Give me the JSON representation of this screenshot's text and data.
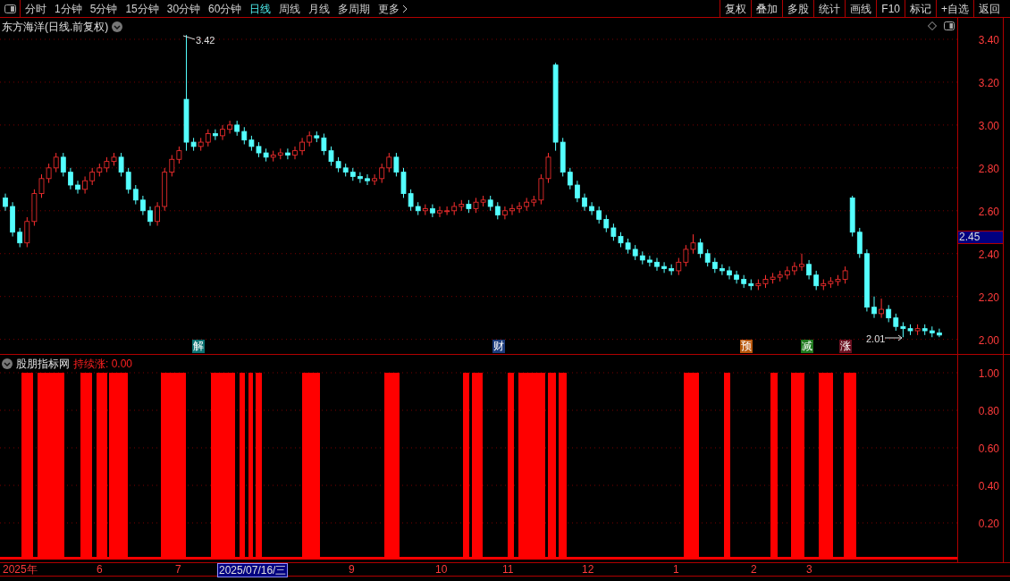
{
  "toolbar": {
    "periods": [
      {
        "label": "分时",
        "selected": false
      },
      {
        "label": "1分钟",
        "selected": false
      },
      {
        "label": "5分钟",
        "selected": false
      },
      {
        "label": "15分钟",
        "selected": false
      },
      {
        "label": "30分钟",
        "selected": false
      },
      {
        "label": "60分钟",
        "selected": false
      },
      {
        "label": "日线",
        "selected": true
      },
      {
        "label": "周线",
        "selected": false
      },
      {
        "label": "月线",
        "selected": false
      },
      {
        "label": "多周期",
        "selected": false
      }
    ],
    "more": "更多",
    "actions": [
      "复权",
      "叠加",
      "多股",
      "统计",
      "画线",
      "F10",
      "标记",
      "+自选",
      "返回"
    ]
  },
  "main_chart": {
    "title": "东方海洋(日线.前复权)",
    "current_price": "2.45",
    "high_label": "3.42",
    "low_label": "2.01",
    "chart_data": {
      "type": "candlestick",
      "ohlc": [
        [
          2.66,
          2.68,
          2.6,
          2.62
        ],
        [
          2.62,
          2.64,
          2.48,
          2.5
        ],
        [
          2.5,
          2.52,
          2.43,
          2.45
        ],
        [
          2.45,
          2.57,
          2.43,
          2.55
        ],
        [
          2.55,
          2.7,
          2.53,
          2.68
        ],
        [
          2.68,
          2.77,
          2.66,
          2.75
        ],
        [
          2.75,
          2.82,
          2.73,
          2.8
        ],
        [
          2.8,
          2.87,
          2.78,
          2.85
        ],
        [
          2.85,
          2.87,
          2.76,
          2.78
        ],
        [
          2.78,
          2.8,
          2.7,
          2.72
        ],
        [
          2.72,
          2.74,
          2.68,
          2.7
        ],
        [
          2.7,
          2.76,
          2.68,
          2.74
        ],
        [
          2.74,
          2.8,
          2.72,
          2.78
        ],
        [
          2.78,
          2.82,
          2.76,
          2.8
        ],
        [
          2.8,
          2.85,
          2.78,
          2.83
        ],
        [
          2.83,
          2.87,
          2.81,
          2.85
        ],
        [
          2.85,
          2.87,
          2.76,
          2.78
        ],
        [
          2.78,
          2.8,
          2.68,
          2.7
        ],
        [
          2.7,
          2.72,
          2.63,
          2.65
        ],
        [
          2.65,
          2.67,
          2.58,
          2.6
        ],
        [
          2.6,
          2.62,
          2.53,
          2.55
        ],
        [
          2.55,
          2.64,
          2.53,
          2.62
        ],
        [
          2.62,
          2.8,
          2.6,
          2.78
        ],
        [
          2.78,
          2.86,
          2.76,
          2.84
        ],
        [
          2.84,
          2.9,
          2.82,
          2.88
        ],
        [
          3.12,
          3.42,
          2.88,
          2.92
        ],
        [
          2.92,
          2.94,
          2.88,
          2.9
        ],
        [
          2.9,
          2.94,
          2.88,
          2.92
        ],
        [
          2.92,
          2.98,
          2.9,
          2.96
        ],
        [
          2.96,
          2.98,
          2.93,
          2.95
        ],
        [
          2.95,
          3.0,
          2.93,
          2.98
        ],
        [
          2.98,
          3.02,
          2.96,
          3.0
        ],
        [
          3.0,
          3.02,
          2.95,
          2.97
        ],
        [
          2.97,
          2.99,
          2.91,
          2.93
        ],
        [
          2.93,
          2.95,
          2.88,
          2.9
        ],
        [
          2.9,
          2.92,
          2.85,
          2.87
        ],
        [
          2.87,
          2.89,
          2.83,
          2.85
        ],
        [
          2.85,
          2.88,
          2.83,
          2.86
        ],
        [
          2.86,
          2.89,
          2.84,
          2.87
        ],
        [
          2.87,
          2.89,
          2.84,
          2.86
        ],
        [
          2.86,
          2.9,
          2.84,
          2.88
        ],
        [
          2.88,
          2.94,
          2.86,
          2.92
        ],
        [
          2.92,
          2.97,
          2.9,
          2.95
        ],
        [
          2.95,
          2.97,
          2.92,
          2.94
        ],
        [
          2.94,
          2.96,
          2.86,
          2.88
        ],
        [
          2.88,
          2.9,
          2.81,
          2.83
        ],
        [
          2.83,
          2.85,
          2.78,
          2.8
        ],
        [
          2.8,
          2.82,
          2.76,
          2.78
        ],
        [
          2.78,
          2.8,
          2.74,
          2.76
        ],
        [
          2.76,
          2.78,
          2.73,
          2.75
        ],
        [
          2.75,
          2.77,
          2.72,
          2.74
        ],
        [
          2.74,
          2.77,
          2.72,
          2.75
        ],
        [
          2.75,
          2.82,
          2.73,
          2.8
        ],
        [
          2.8,
          2.87,
          2.78,
          2.85
        ],
        [
          2.85,
          2.87,
          2.76,
          2.78
        ],
        [
          2.78,
          2.8,
          2.66,
          2.68
        ],
        [
          2.68,
          2.7,
          2.6,
          2.62
        ],
        [
          2.62,
          2.64,
          2.58,
          2.6
        ],
        [
          2.6,
          2.63,
          2.58,
          2.61
        ],
        [
          2.61,
          2.63,
          2.57,
          2.59
        ],
        [
          2.59,
          2.62,
          2.57,
          2.6
        ],
        [
          2.6,
          2.62,
          2.58,
          2.6
        ],
        [
          2.6,
          2.64,
          2.58,
          2.62
        ],
        [
          2.62,
          2.65,
          2.6,
          2.63
        ],
        [
          2.63,
          2.65,
          2.59,
          2.61
        ],
        [
          2.61,
          2.66,
          2.59,
          2.64
        ],
        [
          2.64,
          2.67,
          2.62,
          2.65
        ],
        [
          2.65,
          2.67,
          2.6,
          2.62
        ],
        [
          2.62,
          2.64,
          2.56,
          2.58
        ],
        [
          2.58,
          2.62,
          2.56,
          2.6
        ],
        [
          2.6,
          2.63,
          2.58,
          2.61
        ],
        [
          2.61,
          2.64,
          2.59,
          2.62
        ],
        [
          2.62,
          2.66,
          2.6,
          2.64
        ],
        [
          2.64,
          2.67,
          2.62,
          2.65
        ],
        [
          2.65,
          2.77,
          2.63,
          2.75
        ],
        [
          2.75,
          2.87,
          2.73,
          2.85
        ],
        [
          3.28,
          3.29,
          2.88,
          2.92
        ],
        [
          2.92,
          2.94,
          2.76,
          2.78
        ],
        [
          2.78,
          2.8,
          2.7,
          2.72
        ],
        [
          2.72,
          2.74,
          2.64,
          2.66
        ],
        [
          2.66,
          2.68,
          2.6,
          2.62
        ],
        [
          2.62,
          2.64,
          2.58,
          2.6
        ],
        [
          2.6,
          2.62,
          2.54,
          2.56
        ],
        [
          2.56,
          2.58,
          2.5,
          2.52
        ],
        [
          2.52,
          2.54,
          2.46,
          2.48
        ],
        [
          2.48,
          2.5,
          2.43,
          2.45
        ],
        [
          2.45,
          2.47,
          2.4,
          2.42
        ],
        [
          2.42,
          2.44,
          2.37,
          2.39
        ],
        [
          2.39,
          2.41,
          2.35,
          2.37
        ],
        [
          2.37,
          2.39,
          2.34,
          2.36
        ],
        [
          2.36,
          2.38,
          2.32,
          2.34
        ],
        [
          2.34,
          2.36,
          2.31,
          2.33
        ],
        [
          2.33,
          2.35,
          2.3,
          2.32
        ],
        [
          2.32,
          2.38,
          2.3,
          2.36
        ],
        [
          2.36,
          2.44,
          2.34,
          2.42
        ],
        [
          2.42,
          2.49,
          2.4,
          2.45
        ],
        [
          2.45,
          2.47,
          2.38,
          2.4
        ],
        [
          2.4,
          2.42,
          2.34,
          2.36
        ],
        [
          2.36,
          2.38,
          2.31,
          2.33
        ],
        [
          2.33,
          2.35,
          2.3,
          2.32
        ],
        [
          2.32,
          2.34,
          2.28,
          2.3
        ],
        [
          2.3,
          2.32,
          2.26,
          2.28
        ],
        [
          2.28,
          2.3,
          2.24,
          2.26
        ],
        [
          2.26,
          2.28,
          2.23,
          2.25
        ],
        [
          2.25,
          2.28,
          2.23,
          2.26
        ],
        [
          2.26,
          2.3,
          2.24,
          2.28
        ],
        [
          2.28,
          2.31,
          2.26,
          2.29
        ],
        [
          2.29,
          2.32,
          2.27,
          2.3
        ],
        [
          2.3,
          2.34,
          2.28,
          2.32
        ],
        [
          2.32,
          2.36,
          2.3,
          2.34
        ],
        [
          2.34,
          2.4,
          2.32,
          2.35
        ],
        [
          2.35,
          2.37,
          2.28,
          2.3
        ],
        [
          2.3,
          2.32,
          2.23,
          2.25
        ],
        [
          2.25,
          2.28,
          2.23,
          2.26
        ],
        [
          2.26,
          2.29,
          2.24,
          2.27
        ],
        [
          2.27,
          2.3,
          2.25,
          2.28
        ],
        [
          2.28,
          2.34,
          2.26,
          2.32
        ],
        [
          2.66,
          2.67,
          2.48,
          2.5
        ],
        [
          2.5,
          2.52,
          2.38,
          2.4
        ],
        [
          2.4,
          2.42,
          2.13,
          2.15
        ],
        [
          2.15,
          2.2,
          2.1,
          2.12
        ],
        [
          2.12,
          2.19,
          2.1,
          2.14
        ],
        [
          2.14,
          2.16,
          2.08,
          2.1
        ],
        [
          2.1,
          2.12,
          2.04,
          2.06
        ],
        [
          2.06,
          2.08,
          2.01,
          2.05
        ],
        [
          2.05,
          2.07,
          2.02,
          2.04
        ],
        [
          2.04,
          2.07,
          2.02,
          2.05
        ],
        [
          2.05,
          2.07,
          2.02,
          2.04
        ],
        [
          2.04,
          2.06,
          2.01,
          2.03
        ],
        [
          2.03,
          2.05,
          2.01,
          2.02
        ]
      ],
      "ylim": [
        0.96,
        3.5
      ],
      "grid": true,
      "yticks": [
        {
          "value": 3.4,
          "label": "3.40"
        },
        {
          "value": 3.2,
          "label": "3.20"
        },
        {
          "value": 3.0,
          "label": "3.00"
        },
        {
          "value": 2.8,
          "label": "2.80"
        },
        {
          "value": 2.6,
          "label": "2.60"
        },
        {
          "value": 2.4,
          "label": "2.40"
        },
        {
          "value": 2.2,
          "label": "2.20"
        },
        {
          "value": 2.0,
          "label": "2.00"
        }
      ]
    },
    "events": [
      {
        "label": "解",
        "color": "#0b7272"
      },
      {
        "label": "财",
        "color": "#1c3c7c"
      },
      {
        "label": "预",
        "color": "#b8560a"
      },
      {
        "label": "减",
        "color": "#1f7a1f"
      },
      {
        "label": "涨",
        "color": "#6a1020"
      }
    ]
  },
  "indicator": {
    "name": "股朋指标网",
    "value_label": "持续涨: 0.00",
    "ticks": [
      "1.00",
      "0.80",
      "0.60",
      "0.40",
      "0.20"
    ]
  },
  "date_axis": [
    {
      "label": "2025年",
      "kind": "tick"
    },
    {
      "label": "6",
      "kind": "tick"
    },
    {
      "label": "7",
      "kind": "tick"
    },
    {
      "label": "2025/07/16/三",
      "kind": "cursor"
    },
    {
      "label": "9",
      "kind": "tick"
    },
    {
      "label": "10",
      "kind": "tick"
    },
    {
      "label": "11",
      "kind": "tick"
    },
    {
      "label": "12",
      "kind": "tick"
    },
    {
      "label": "1",
      "kind": "tick"
    },
    {
      "label": "2",
      "kind": "tick"
    },
    {
      "label": "3",
      "kind": "tick"
    }
  ]
}
